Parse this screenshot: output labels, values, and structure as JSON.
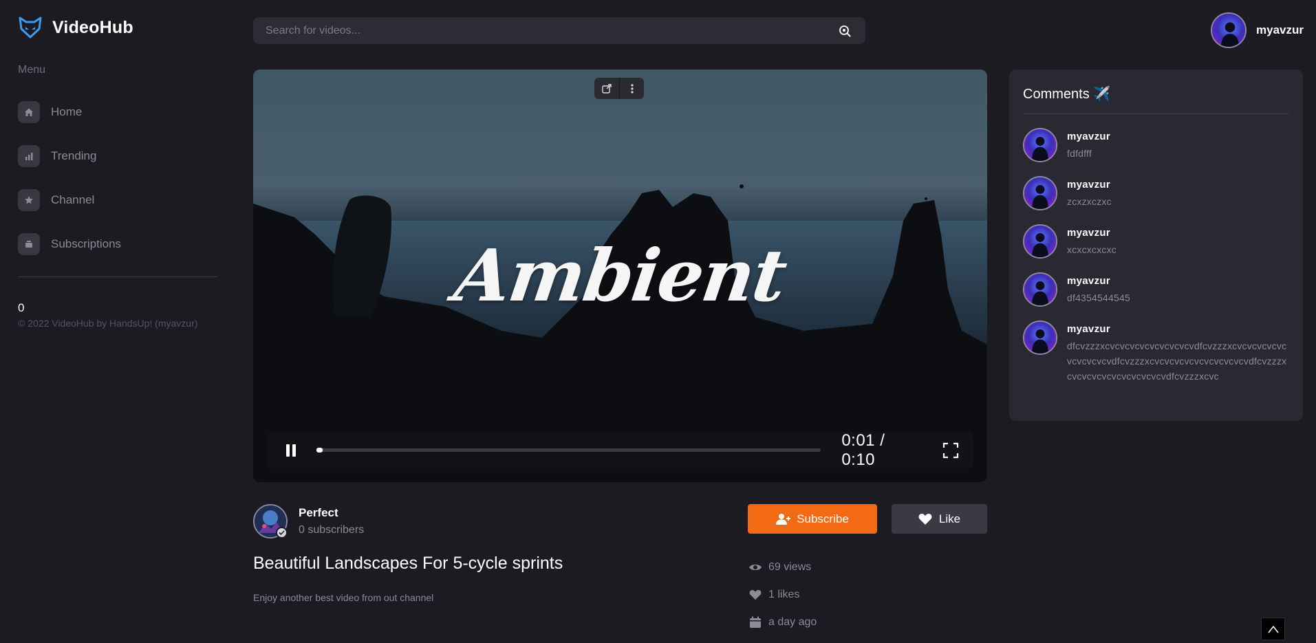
{
  "app": {
    "name": "VideoHub"
  },
  "sidebar": {
    "menu_title": "Menu",
    "items": [
      {
        "label": "Home",
        "icon": "home-icon"
      },
      {
        "label": "Trending",
        "icon": "chart-icon"
      },
      {
        "label": "Channel",
        "icon": "star-icon"
      },
      {
        "label": "Subscriptions",
        "icon": "inbox-icon"
      }
    ],
    "counter": "0",
    "copyright": "© 2022 VideoHub by HandsUp! (myavzur)"
  },
  "search": {
    "placeholder": "Search for videos..."
  },
  "user": {
    "name": "myavzur"
  },
  "player": {
    "overlay_title": "Ambient",
    "time": "0:01 / 0:10",
    "progress": 0.012,
    "state": "playing"
  },
  "channel": {
    "name": "Perfect",
    "subscribers": "0 subscribers"
  },
  "buttons": {
    "subscribe": "Subscribe",
    "like": "Like"
  },
  "video": {
    "title": "Beautiful Landscapes For 5-cycle sprints",
    "description": "Enjoy another best video from out channel"
  },
  "stats": {
    "views": "69 views",
    "likes": "1 likes",
    "date": "a day ago"
  },
  "comments": {
    "title": "Comments ✈️",
    "items": [
      {
        "user": "myavzur",
        "text": "fdfdfff"
      },
      {
        "user": "myavzur",
        "text": "zcxzxczxc"
      },
      {
        "user": "myavzur",
        "text": "xcxcxcxcxc"
      },
      {
        "user": "myavzur",
        "text": "df4354544545"
      },
      {
        "user": "myavzur",
        "text": "dfcvzzzxcvcvcvcvcvcvcvcvcvdfcvzzzxcvcvcvcvcvcvcvcvcvcvdfcvzzzxcvcvcvcvcvcvcvcvcvcvdfcvzzzxcvcvcvcvcvcvcvcvcvcvdfcvzzzxcvc"
      }
    ]
  },
  "colors": {
    "accent": "#f26b14",
    "background": "#1c1b22",
    "panel": "#2a2933"
  }
}
